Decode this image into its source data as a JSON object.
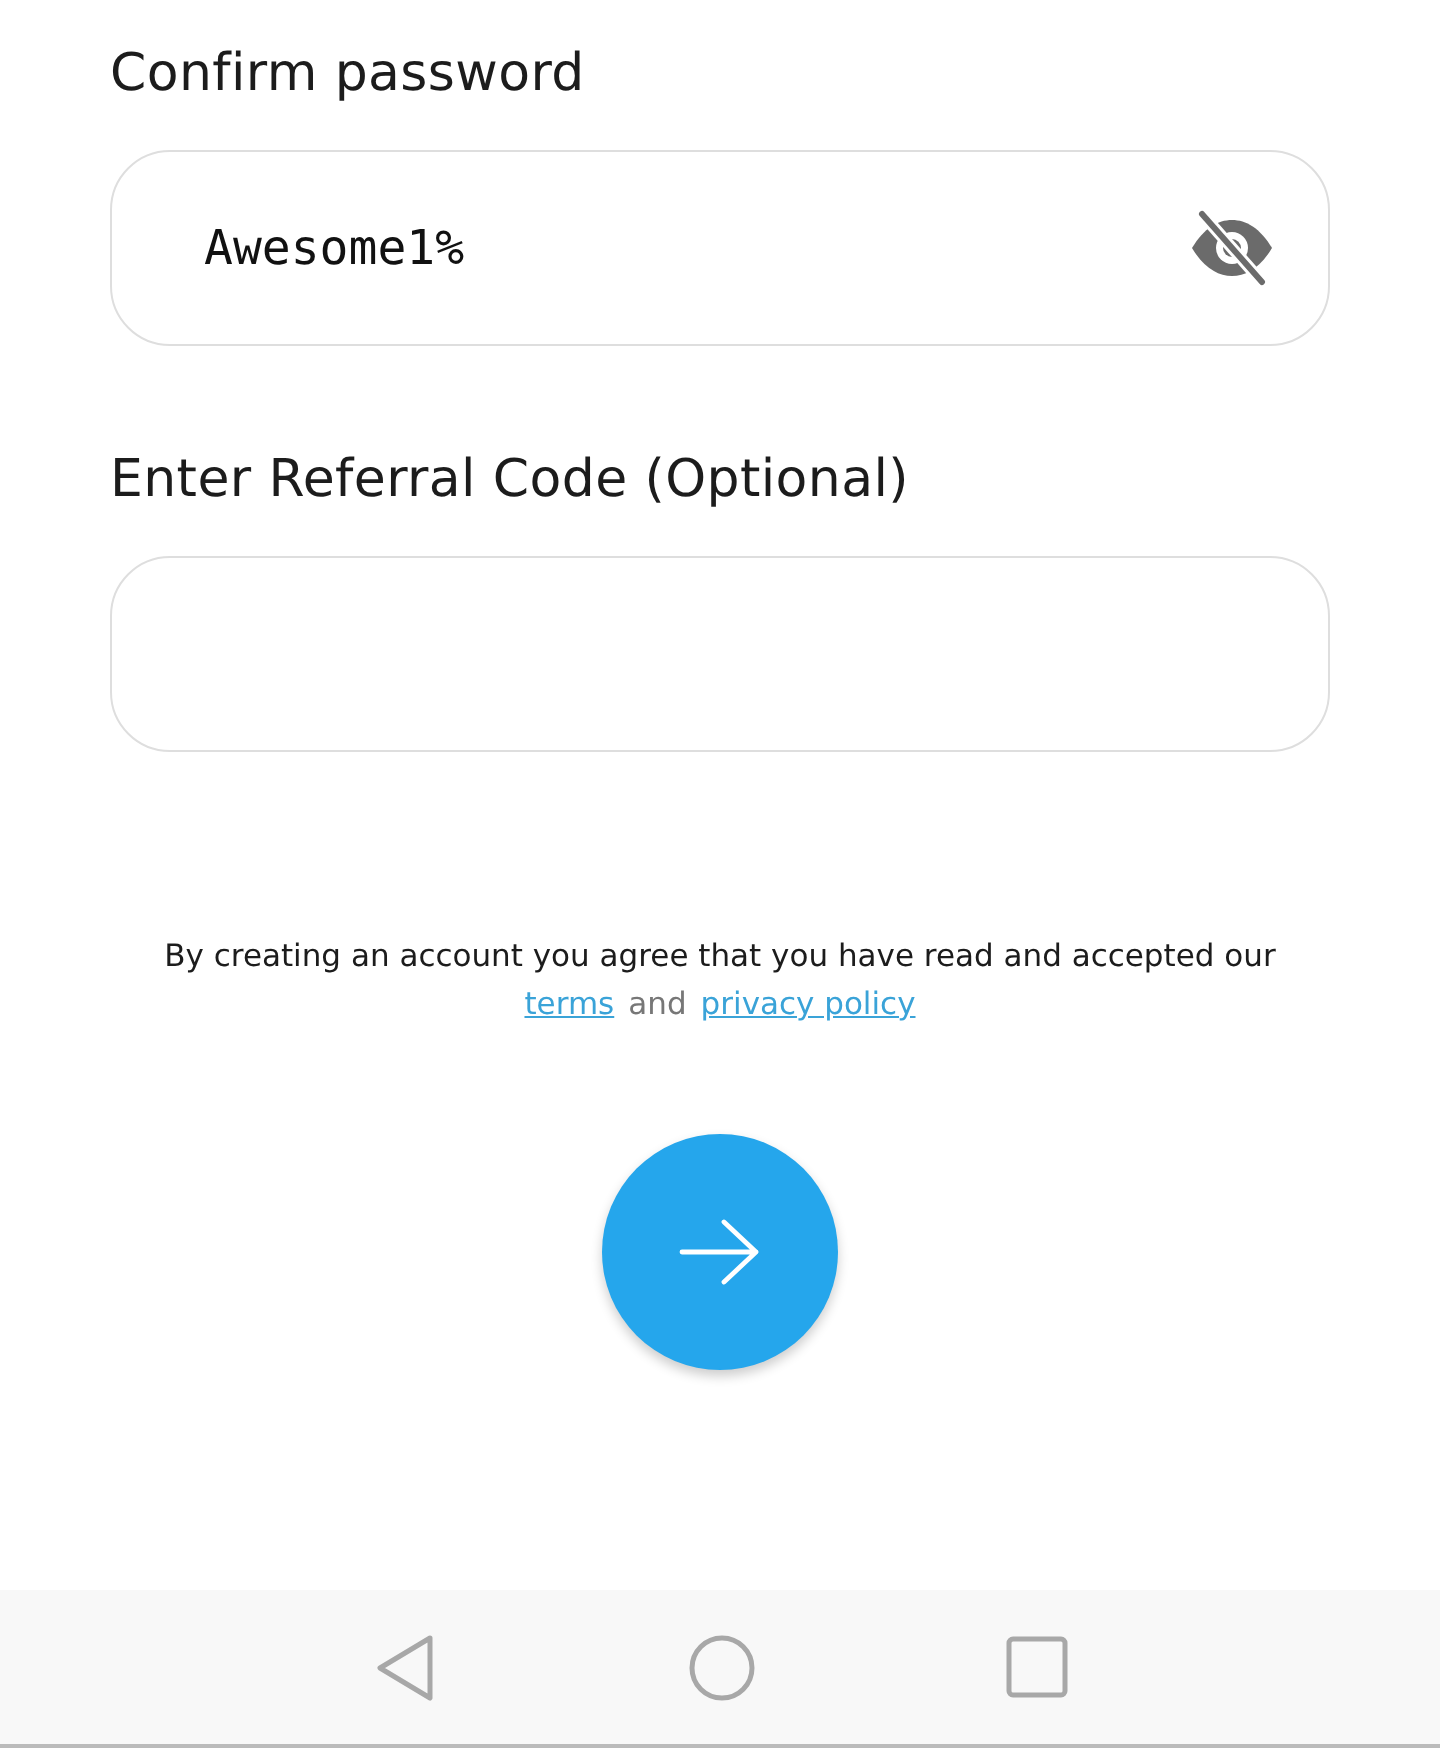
{
  "fields": [
    {
      "kind": "password",
      "label": "Confirm password",
      "value": "Awesome1%"
    },
    {
      "kind": "text",
      "label": "Enter Referral Code (Optional)"
    }
  ],
  "consent": {
    "text": "By creating an account you agree that you have read and accepted our",
    "links": [
      "terms",
      "privacy policy"
    ],
    "joiner": "and"
  }
}
